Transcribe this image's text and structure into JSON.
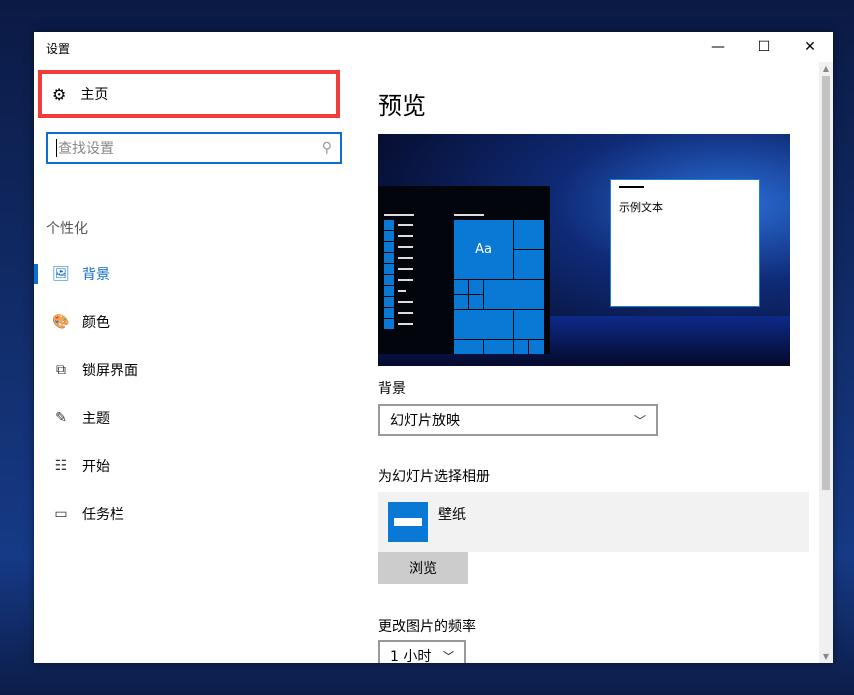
{
  "window": {
    "title": "设置",
    "minimize": "—",
    "maximize": "☐",
    "close": "✕"
  },
  "sidebar": {
    "home": "主页",
    "search_placeholder": "查找设置",
    "section": "个性化",
    "items": [
      {
        "label": "背景",
        "icon": "picture-icon",
        "glyph": "🖼"
      },
      {
        "label": "颜色",
        "icon": "palette-icon",
        "glyph": "🎨"
      },
      {
        "label": "锁屏界面",
        "icon": "lock-screen-icon",
        "glyph": "⧉"
      },
      {
        "label": "主题",
        "icon": "theme-icon",
        "glyph": "✎"
      },
      {
        "label": "开始",
        "icon": "start-icon",
        "glyph": "☷"
      },
      {
        "label": "任务栏",
        "icon": "taskbar-icon",
        "glyph": "▭"
      }
    ]
  },
  "main": {
    "title": "预览",
    "preview": {
      "tile_label": "Aa",
      "sample_text": "示例文本"
    },
    "background_label": "背景",
    "background_value": "幻灯片放映",
    "album_label": "为幻灯片选择相册",
    "album_name": "壁纸",
    "browse": "浏览",
    "freq_label": "更改图片的频率",
    "freq_value": "1 小时"
  },
  "colors": {
    "accent": "#0a79d6",
    "highlight": "#f23c3c"
  }
}
